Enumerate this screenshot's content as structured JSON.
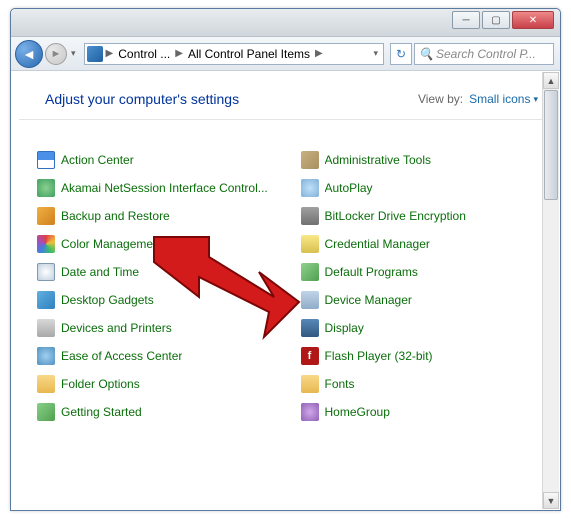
{
  "breadcrumbs": [
    "Control ...",
    "All Control Panel Items"
  ],
  "search_placeholder": "Search Control P...",
  "heading": "Adjust your computer's settings",
  "viewby_label": "View by:",
  "viewby_value": "Small icons",
  "left_items": [
    {
      "label": "Action Center",
      "icon": "i-flag"
    },
    {
      "label": "Akamai NetSession Interface Control...",
      "icon": "i-globe"
    },
    {
      "label": "Backup and Restore",
      "icon": "i-bk"
    },
    {
      "label": "Color Management",
      "icon": "i-color"
    },
    {
      "label": "Date and Time",
      "icon": "i-clock"
    },
    {
      "label": "Desktop Gadgets",
      "icon": "i-gadget"
    },
    {
      "label": "Devices and Printers",
      "icon": "i-print"
    },
    {
      "label": "Ease of Access Center",
      "icon": "i-ease"
    },
    {
      "label": "Folder Options",
      "icon": "i-folder"
    },
    {
      "label": "Getting Started",
      "icon": "i-start"
    }
  ],
  "right_items": [
    {
      "label": "Administrative Tools",
      "icon": "i-admin"
    },
    {
      "label": "AutoPlay",
      "icon": "i-auto"
    },
    {
      "label": "BitLocker Drive Encryption",
      "icon": "i-bitl"
    },
    {
      "label": "Credential Manager",
      "icon": "i-cred"
    },
    {
      "label": "Default Programs",
      "icon": "i-def"
    },
    {
      "label": "Device Manager",
      "icon": "i-dev"
    },
    {
      "label": "Display",
      "icon": "i-disp"
    },
    {
      "label": "Flash Player (32-bit)",
      "icon": "i-flash"
    },
    {
      "label": "Fonts",
      "icon": "i-fonts"
    },
    {
      "label": "HomeGroup",
      "icon": "i-home"
    }
  ]
}
